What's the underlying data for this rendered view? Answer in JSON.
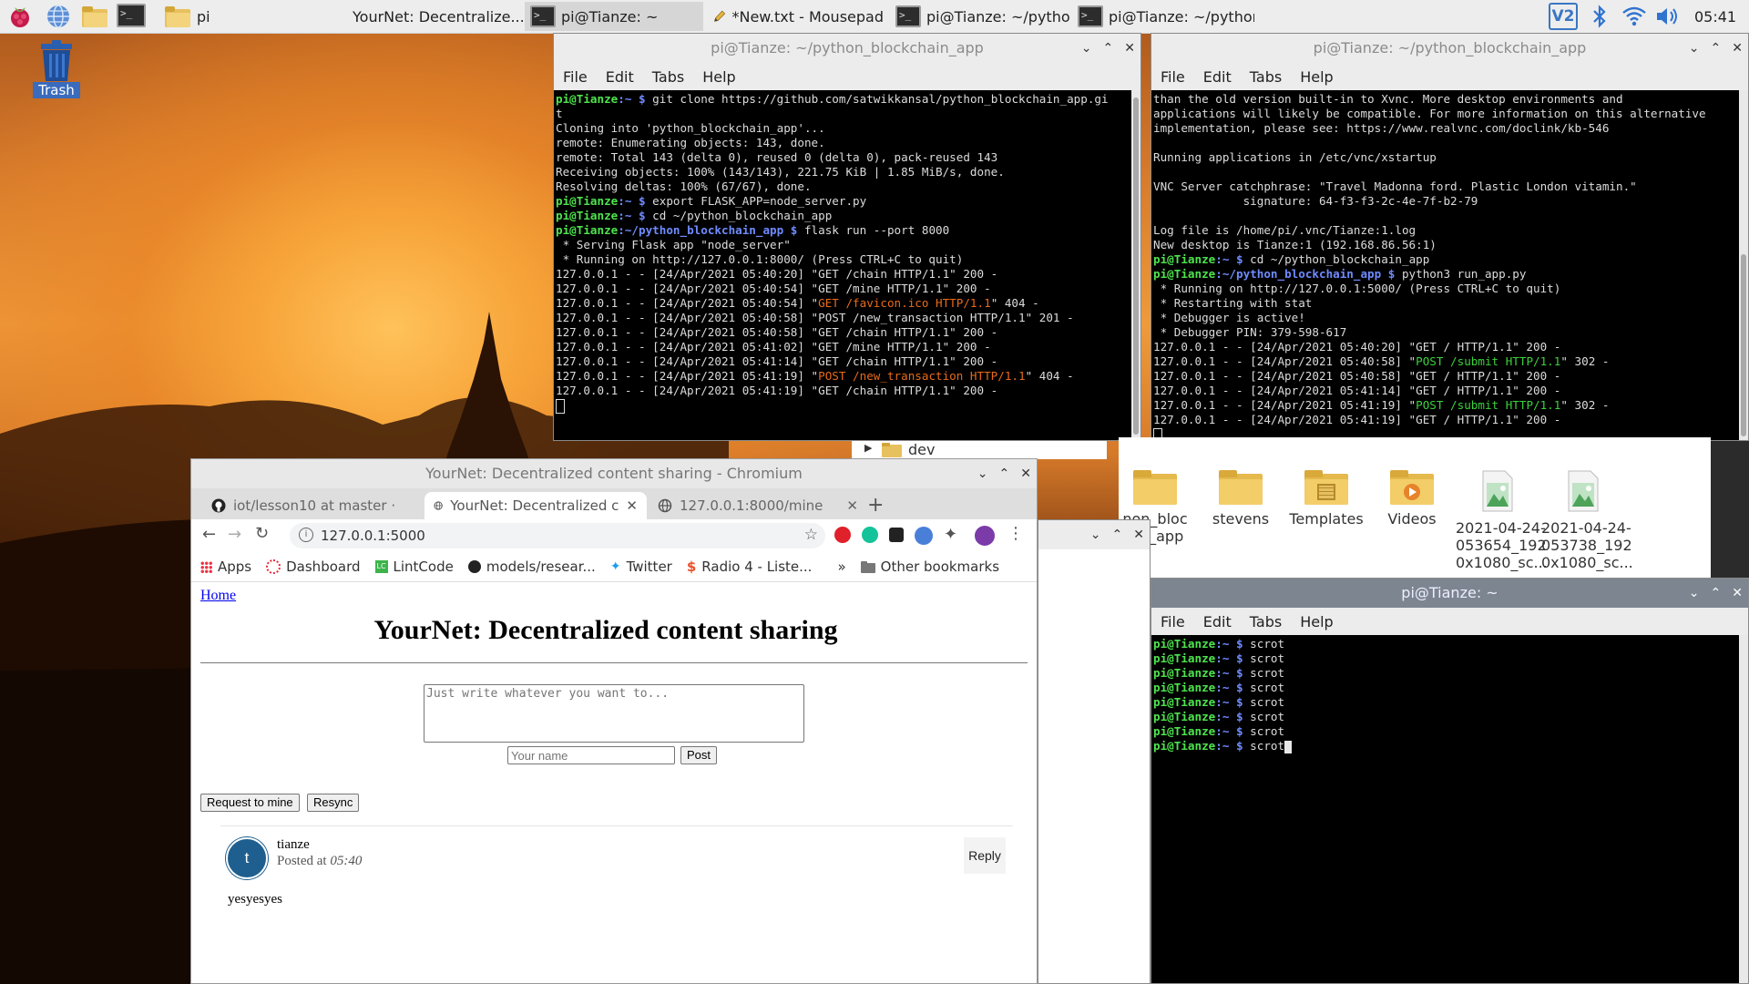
{
  "taskbar": {
    "tasks": [
      {
        "label": "pi"
      },
      {
        "label": "YourNet: Decentralize..."
      },
      {
        "label": "pi@Tianze: ~"
      },
      {
        "label": "*New.txt - Mousepad"
      },
      {
        "label": "pi@Tianze: ~/python..."
      },
      {
        "label": "pi@Tianze: ~/python..."
      }
    ],
    "clock": "05:41",
    "vnc_label": "V2"
  },
  "desktop": {
    "trash_label": "Trash"
  },
  "term_left": {
    "title": "pi@Tianze: ~/python_blockchain_app",
    "menu": [
      "File",
      "Edit",
      "Tabs",
      "Help"
    ],
    "lines": [
      {
        "u": "pi@Tianze",
        "p": ":~ $",
        "t": " git clone https://github.com/satwikkansal/python_blockchain_app.gi"
      },
      {
        "t": "t"
      },
      {
        "t": "Cloning into 'python_blockchain_app'..."
      },
      {
        "t": "remote: Enumerating objects: 143, done."
      },
      {
        "t": "remote: Total 143 (delta 0), reused 0 (delta 0), pack-reused 143"
      },
      {
        "t": "Receiving objects: 100% (143/143), 221.75 KiB | 1.85 MiB/s, done."
      },
      {
        "t": "Resolving deltas: 100% (67/67), done."
      },
      {
        "u": "pi@Tianze",
        "p": ":~ $",
        "t": " export FLASK_APP=node_server.py"
      },
      {
        "u": "pi@Tianze",
        "p": ":~ $",
        "t": " cd ~/python_blockchain_app"
      },
      {
        "u": "pi@Tianze",
        "p": ":~/python_blockchain_app $",
        "t": " flask run --port 8000"
      },
      {
        "t": " * Serving Flask app \"node_server\""
      },
      {
        "t": " * Running on http://127.0.0.1:8000/ (Press CTRL+C to quit)"
      },
      {
        "t": "127.0.0.1 - - [24/Apr/2021 05:40:20] \"GET /chain HTTP/1.1\" 200 -"
      },
      {
        "t": "127.0.0.1 - - [24/Apr/2021 05:40:54] \"GET /mine HTTP/1.1\" 200 -"
      },
      {
        "t": "127.0.0.1 - - [24/Apr/2021 05:40:54] \"",
        "o": "GET /favicon.ico HTTP/1.1",
        "t2": "\" 404 -"
      },
      {
        "t": "127.0.0.1 - - [24/Apr/2021 05:40:58] \"POST /new_transaction HTTP/1.1\" 201 -"
      },
      {
        "t": "127.0.0.1 - - [24/Apr/2021 05:40:58] \"GET /chain HTTP/1.1\" 200 -"
      },
      {
        "t": "127.0.0.1 - - [24/Apr/2021 05:41:02] \"GET /mine HTTP/1.1\" 200 -"
      },
      {
        "t": "127.0.0.1 - - [24/Apr/2021 05:41:14] \"GET /chain HTTP/1.1\" 200 -"
      },
      {
        "t": "127.0.0.1 - - [24/Apr/2021 05:41:19] \"",
        "o": "POST /new_transaction HTTP/1.1",
        "t2": "\" 404 -"
      },
      {
        "t": "127.0.0.1 - - [24/Apr/2021 05:41:19] \"GET /chain HTTP/1.1\" 200 -"
      }
    ]
  },
  "term_right": {
    "title": "pi@Tianze: ~/python_blockchain_app",
    "menu": [
      "File",
      "Edit",
      "Tabs",
      "Help"
    ],
    "lines": [
      {
        "t": "than the old version built-in to Xvnc. More desktop environments and"
      },
      {
        "t": "applications will likely be compatible. For more information on this alternative"
      },
      {
        "t": "implementation, please see: https://www.realvnc.com/doclink/kb-546"
      },
      {
        "t": ""
      },
      {
        "t": "Running applications in /etc/vnc/xstartup"
      },
      {
        "t": ""
      },
      {
        "t": "VNC Server catchphrase: \"Travel Madonna ford. Plastic London vitamin.\""
      },
      {
        "t": "             signature: 64-f3-f3-2c-4e-7f-b2-79"
      },
      {
        "t": ""
      },
      {
        "t": "Log file is /home/pi/.vnc/Tianze:1.log"
      },
      {
        "t": "New desktop is Tianze:1 (192.168.86.56:1)"
      },
      {
        "u": "pi@Tianze",
        "p": ":~ $",
        "t": " cd ~/python_blockchain_app"
      },
      {
        "u": "pi@Tianze",
        "p": ":~/python_blockchain_app $",
        "t": " python3 run_app.py"
      },
      {
        "t": " * Running on http://127.0.0.1:5000/ (Press CTRL+C to quit)"
      },
      {
        "t": " * Restarting with stat"
      },
      {
        "t": " * Debugger is active!"
      },
      {
        "t": " * Debugger PIN: 379-598-617"
      },
      {
        "t": "127.0.0.1 - - [24/Apr/2021 05:40:20] \"GET / HTTP/1.1\" 200 -"
      },
      {
        "t": "127.0.0.1 - - [24/Apr/2021 05:40:58] \"",
        "g": "POST /submit HTTP/1.1",
        "t2": "\" 302 -"
      },
      {
        "t": "127.0.0.1 - - [24/Apr/2021 05:40:58] \"GET / HTTP/1.1\" 200 -"
      },
      {
        "t": "127.0.0.1 - - [24/Apr/2021 05:41:14] \"GET / HTTP/1.1\" 200 -"
      },
      {
        "t": "127.0.0.1 - - [24/Apr/2021 05:41:19] \"",
        "g": "POST /submit HTTP/1.1",
        "t2": "\" 302 -"
      },
      {
        "t": "127.0.0.1 - - [24/Apr/2021 05:41:19] \"GET / HTTP/1.1\" 200 -"
      }
    ]
  },
  "term_small": {
    "title": "pi@Tianze: ~",
    "menu": [
      "File",
      "Edit",
      "Tabs",
      "Help"
    ],
    "lines": [
      {
        "u": "pi@Tianze",
        "p": ":~ $",
        "t": " scrot"
      },
      {
        "u": "pi@Tianze",
        "p": ":~ $",
        "t": " scrot"
      },
      {
        "u": "pi@Tianze",
        "p": ":~ $",
        "t": " scrot"
      },
      {
        "u": "pi@Tianze",
        "p": ":~ $",
        "t": " scrot"
      },
      {
        "u": "pi@Tianze",
        "p": ":~ $",
        "t": " scrot"
      },
      {
        "u": "pi@Tianze",
        "p": ":~ $",
        "t": " scrot"
      },
      {
        "u": "pi@Tianze",
        "p": ":~ $",
        "t": " scrot"
      },
      {
        "u": "pi@Tianze",
        "p": ":~ $",
        "t": " scrot"
      }
    ]
  },
  "file_manager": {
    "tree_item": "dev",
    "path_fragment": "ython",
    "items": [
      {
        "label": "non_bloc\nain_app",
        "kind": "folder"
      },
      {
        "label": "stevens",
        "kind": "folder"
      },
      {
        "label": "Templates",
        "kind": "templates"
      },
      {
        "label": "Videos",
        "kind": "videos"
      },
      {
        "label": "2021-04-24-\n053654_192\n0x1080_sc...",
        "kind": "image"
      },
      {
        "label": "2021-04-24-\n053738_192\n0x1080_sc...",
        "kind": "image"
      }
    ]
  },
  "browser": {
    "window_title": "YourNet: Decentralized content sharing - Chromium",
    "tabs": [
      {
        "label": "iot/lesson10 at master · "
      },
      {
        "label": "YourNet: Decentralized c"
      },
      {
        "label": "127.0.0.1:8000/mine"
      }
    ],
    "url": "127.0.0.1:5000",
    "bookmarks": [
      "Apps",
      "Dashboard",
      "LintCode",
      "models/resear...",
      "Twitter",
      "Radio 4 - Liste..."
    ],
    "other_bookmarks": "Other bookmarks",
    "page": {
      "home_link": "Home",
      "heading": "YourNet: Decentralized content sharing",
      "textarea_placeholder": "Just write whatever you want to...",
      "name_placeholder": "Your name",
      "post_button": "Post",
      "mine_button": "Request to mine",
      "resync_button": "Resync",
      "post": {
        "avatar_letter": "t",
        "author": "tianze",
        "posted_at_prefix": "Posted at ",
        "time": "05:40",
        "reply": "Reply",
        "content": "yesyesyes"
      }
    }
  }
}
